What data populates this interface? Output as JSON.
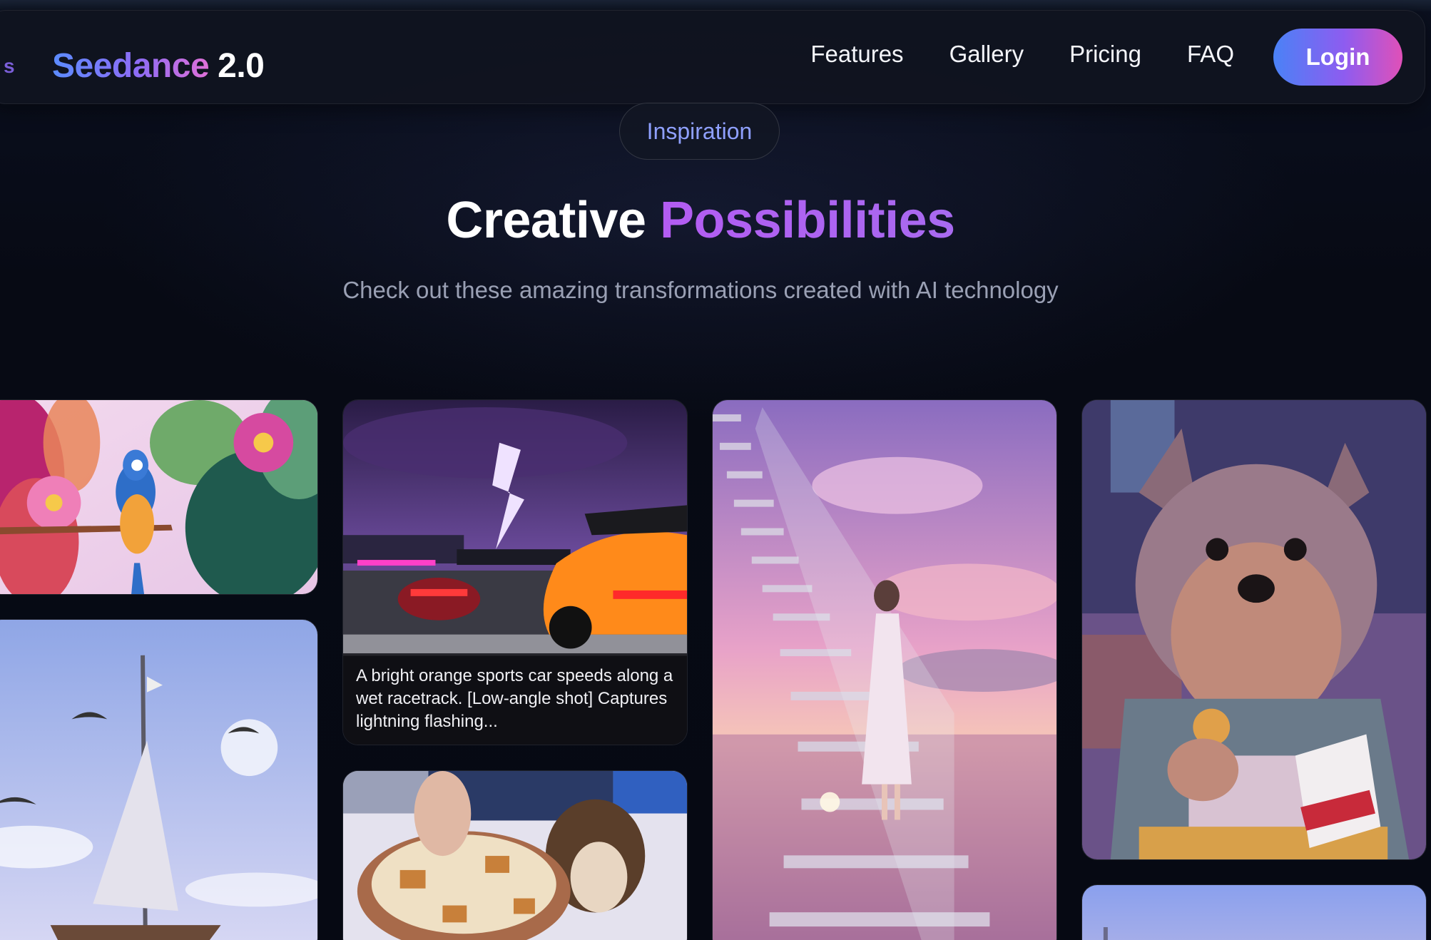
{
  "nav": {
    "brand_prefix": "s",
    "brand_name": "Seedance",
    "brand_version": "2.0",
    "links": [
      "Features",
      "Gallery",
      "Pricing",
      "FAQ"
    ],
    "login_label": "Login"
  },
  "hero": {
    "badge": "Inspiration",
    "title_plain": "Creative",
    "title_highlight": "Possibilities",
    "subtitle": "Check out these amazing transformations created with AI technology"
  },
  "gallery": {
    "cards": [
      {
        "subject": "tropical parrot illustration"
      },
      {
        "subject": "sports car on racetrack with lightning",
        "caption": "A bright orange sports car speeds along a wet racetrack. [Low-angle shot] Captures lightning flashing..."
      },
      {
        "subject": "woman on glass staircase above clouds"
      },
      {
        "subject": "yorkshire terrier in denim jacket eating chips"
      },
      {
        "subject": "sailboat with seagulls"
      },
      {
        "subject": "pot of fondue in snow with dog"
      }
    ]
  },
  "colors": {
    "background": "#070a14",
    "accent_blue": "#5b8cff",
    "accent_purple": "#b35cf2",
    "accent_pink": "#e050b8"
  }
}
